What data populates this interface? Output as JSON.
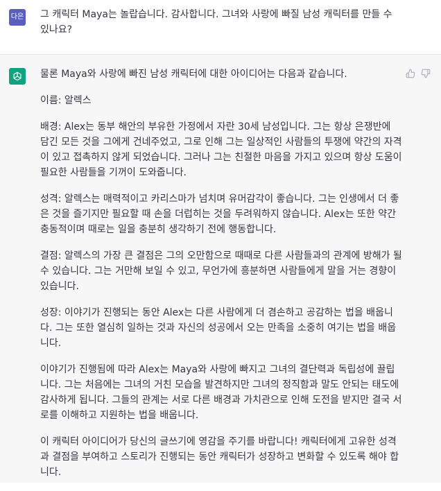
{
  "user_message": {
    "avatar_text": "다은",
    "text": "그 캐릭터 Maya는 놀랍습니다. 감사합니다. 그녀와 사랑에 빠질 남성 캐릭터를 만들 수 있나요?"
  },
  "assistant_message": {
    "icons": {
      "avatar": "openai-logo-icon",
      "like": "thumbs-up-icon",
      "dislike": "thumbs-down-icon"
    },
    "paragraphs": [
      "물론 Maya와 사랑에 빠진 남성 캐릭터에 대한 아이디어는 다음과 같습니다.",
      "이름: 알렉스",
      "배경: Alex는 동부 해안의 부유한 가정에서 자란 30세 남성입니다. 그는 항상 은쟁반에 담긴 모든 것을 그에게 건네주었고, 그로 인해 그는 일상적인 사람들의 투쟁에 약간의 자격이 있고 접촉하지 않게 되었습니다. 그러나 그는 친절한 마음을 가지고 있으며 항상 도움이 필요한 사람들을 기꺼이 도와줍니다.",
      "성격: 알렉스는 매력적이고 카리스마가 넘치며 유머감각이 좋습니다. 그는 인생에서 더 좋은 것을 즐기지만 필요할 때 손을 더럽히는 것을 두려워하지 않습니다. Alex는 또한 약간 충동적이며 때로는 일을 충분히 생각하기 전에 행동합니다.",
      "결점: 알렉스의 가장 큰 결점은 그의 오만함으로 때때로 다른 사람들과의 관계에 방해가 될 수 있습니다. 그는 거만해 보일 수 있고, 무언가에 흥분하면 사람들에게 말을 거는 경향이 있습니다.",
      "성장: 이야기가 진행되는 동안 Alex는 다른 사람에게 더 겸손하고 공감하는 법을 배웁니다. 그는 또한 열심히 일하는 것과 자신의 성공에서 오는 만족을 소중히 여기는 법을 배웁니다.",
      "이야기가 진행됨에 따라 Alex는 Maya와 사랑에 빠지고 그녀의 결단력과 독립성에 끌립니다. 그는 처음에는 그녀의 거친 모습을 발견하지만 그녀의 정직함과 말도 안되는 태도에 감사하게 됩니다. 그들의 관계는 서로 다른 배경과 가치관으로 인해 도전을 받지만 결국 서로를 이해하고 지원하는 법을 배웁니다.",
      "이 캐릭터 아이디어가 당신의 글쓰기에 영감을 주기를 바랍니다! 캐릭터에게 고유한 성격과 결점을 부여하고 스토리가 진행되는 동안 캐릭터가 성장하고 변화할 수 있도록 해야 합니다."
    ]
  }
}
